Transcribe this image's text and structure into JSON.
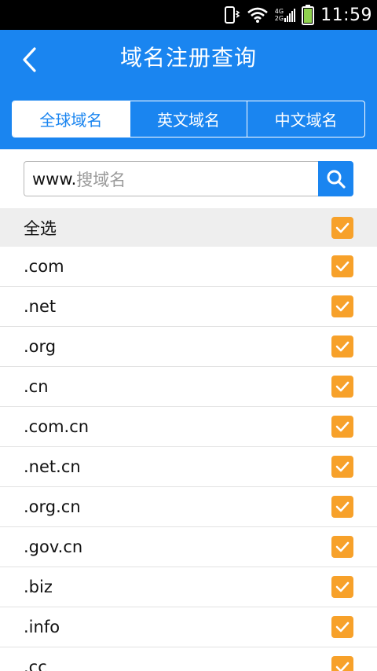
{
  "status_bar": {
    "time": "11:59",
    "network_top": "4G",
    "network_bottom": "2G",
    "icons": [
      "vibrate-icon",
      "wifi-icon",
      "signal-icon",
      "battery-icon"
    ]
  },
  "header": {
    "title": "域名注册查询",
    "back_icon": "chevron-left-icon"
  },
  "tabs": [
    {
      "label": "全球域名",
      "active": true
    },
    {
      "label": "英文域名",
      "active": false
    },
    {
      "label": "中文域名",
      "active": false
    }
  ],
  "search": {
    "prefix": "www.",
    "placeholder": "搜域名",
    "button_icon": "search-icon"
  },
  "select_all": {
    "label": "全选",
    "checked": true
  },
  "domains": [
    {
      "label": ".com",
      "checked": true
    },
    {
      "label": ".net",
      "checked": true
    },
    {
      "label": ".org",
      "checked": true
    },
    {
      "label": ".cn",
      "checked": true
    },
    {
      "label": ".com.cn",
      "checked": true
    },
    {
      "label": ".net.cn",
      "checked": true
    },
    {
      "label": ".org.cn",
      "checked": true
    },
    {
      "label": ".gov.cn",
      "checked": true
    },
    {
      "label": ".biz",
      "checked": true
    },
    {
      "label": ".info",
      "checked": true
    },
    {
      "label": ".cc",
      "checked": true
    }
  ],
  "colors": {
    "primary": "#1a85f0",
    "checkbox": "#f7a12a",
    "status_bar": "#000000",
    "battery": "#8fd14f"
  }
}
